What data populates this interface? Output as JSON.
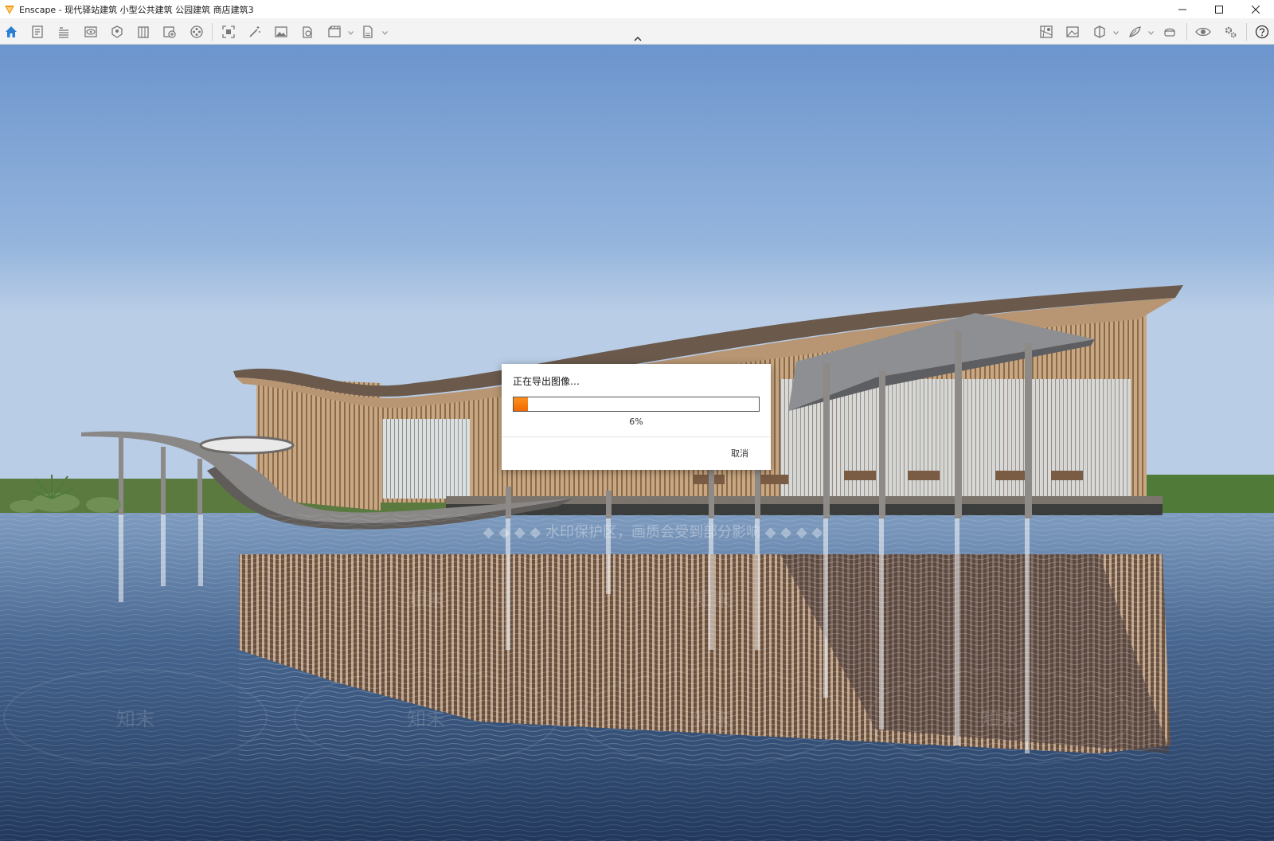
{
  "window": {
    "title": "Enscape - 现代驿站建筑 小型公共建筑 公园建筑 商店建筑3",
    "brand_color": "#f39a1e",
    "controls": [
      "minimize-icon",
      "maximize-icon",
      "close-icon"
    ]
  },
  "toolbar": {
    "accent_color": "#2a7fd4",
    "left_icons": [
      "home-icon",
      "document-icon",
      "bim-icon",
      "eye-view-icon",
      "views-icon",
      "building-icon",
      "asset-library-icon",
      "video-icon",
      "screenshot-icon",
      "magic-wand-icon",
      "image-icon",
      "panorama-icon",
      "batch-render-icon",
      "export-icon"
    ],
    "right_icons": [
      "map-icon",
      "image-gallery-icon",
      "section-icon",
      "material-icon",
      "vr-headset-icon",
      "visibility-icon",
      "settings-icon",
      "help-icon"
    ]
  },
  "dialog": {
    "title": "正在导出图像…",
    "progress": 0.06,
    "progress_text": "6%",
    "cancel_label": "取消",
    "progress_color": "#f07a10"
  },
  "watermark": {
    "banner_text": "◆ ◆ ◆ ◆ 水印保护区，画质会受到部分影响 ◆ ◆ ◆ ◆",
    "tile_text": "知末"
  }
}
